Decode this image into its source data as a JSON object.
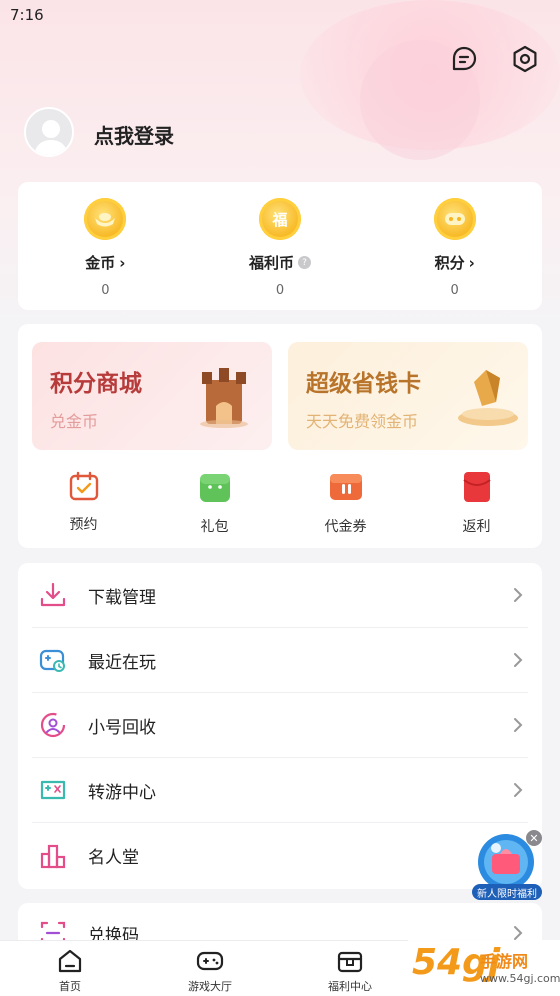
{
  "status": {
    "time": "7:16"
  },
  "header": {
    "login_text": "点我登录"
  },
  "wallet": {
    "items": [
      {
        "label": "金币",
        "value": "0",
        "icon": "coin-icon"
      },
      {
        "label": "福利币",
        "value": "0",
        "icon": "welfare-coin-icon",
        "badge": "福"
      },
      {
        "label": "积分",
        "value": "0",
        "icon": "points-icon"
      }
    ]
  },
  "promo": {
    "left": {
      "title": "积分商城",
      "subtitle": "兑金币"
    },
    "right": {
      "title": "超级省钱卡",
      "subtitle": "天天免费领金币"
    }
  },
  "shortcuts": [
    {
      "label": "预约",
      "icon": "calendar-icon"
    },
    {
      "label": "礼包",
      "icon": "gift-icon"
    },
    {
      "label": "代金券",
      "icon": "voucher-icon"
    },
    {
      "label": "返利",
      "icon": "red-envelope-icon"
    }
  ],
  "menu": [
    {
      "label": "下载管理",
      "icon": "download-icon"
    },
    {
      "label": "最近在玩",
      "icon": "recent-game-icon"
    },
    {
      "label": "小号回收",
      "icon": "account-recycle-icon"
    },
    {
      "label": "转游中心",
      "icon": "transfer-game-icon"
    },
    {
      "label": "名人堂",
      "icon": "hall-of-fame-icon"
    }
  ],
  "menu2": [
    {
      "label": "兑换码",
      "icon": "redeem-code-icon"
    }
  ],
  "floating": {
    "text": "新人限时福利"
  },
  "nav": [
    {
      "label": "首页",
      "icon": "home-icon"
    },
    {
      "label": "游戏大厅",
      "icon": "gamepad-icon"
    },
    {
      "label": "福利中心",
      "icon": "welfare-center-icon"
    },
    {
      "label": "",
      "icon": ""
    }
  ],
  "watermark": {
    "num": "54gj",
    "cn": "手游网",
    "url": "www.54gj.com"
  },
  "colors": {
    "accent_pink": "#e34d8a",
    "coin_gold": "#f7b51e",
    "menu_bg": "#ffffff"
  }
}
